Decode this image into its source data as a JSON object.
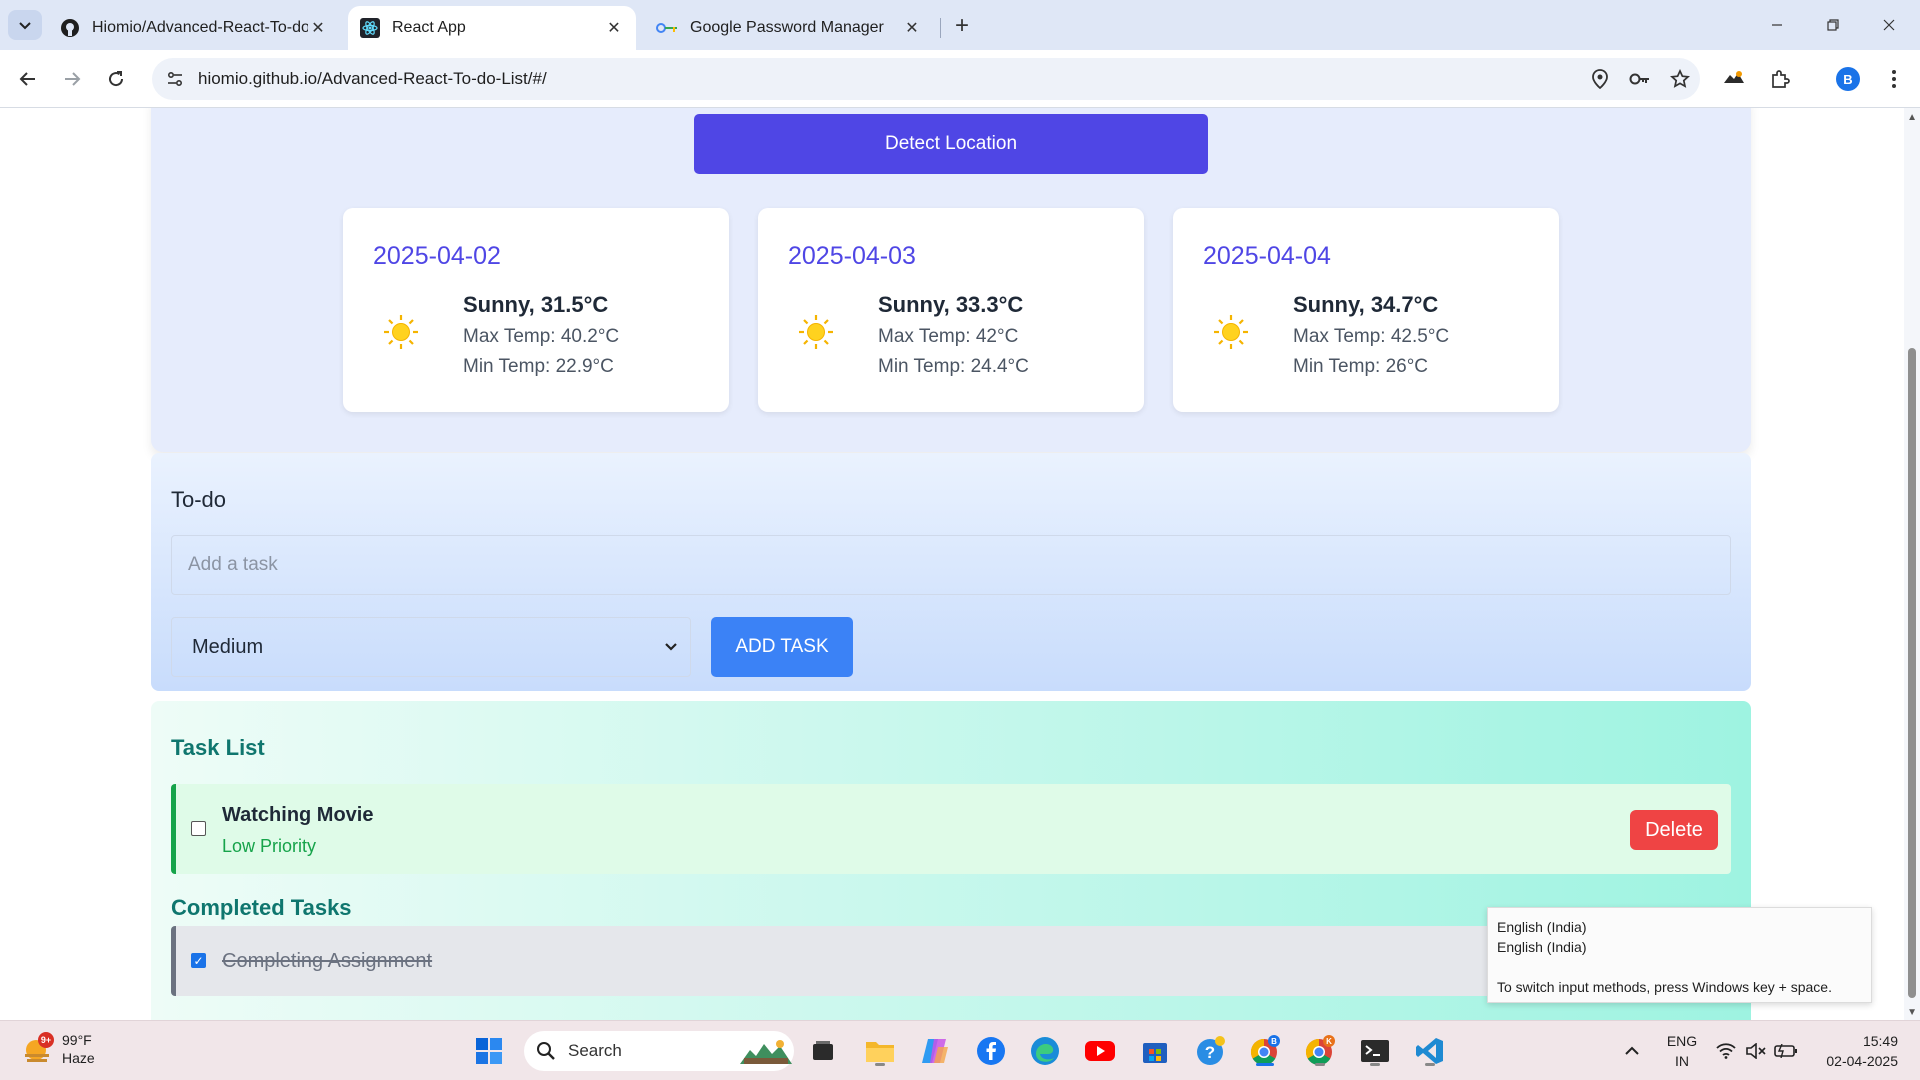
{
  "browser": {
    "tabs": [
      {
        "title": "Hiomio/Advanced-React-To-do",
        "icon": "github-icon",
        "active": false
      },
      {
        "title": "React App",
        "icon": "react-icon",
        "active": true
      },
      {
        "title": "Google Password Manager",
        "icon": "password-manager-icon",
        "active": false
      }
    ],
    "url": "hiomio.github.io/Advanced-React-To-do-List/#/",
    "profile_initial": "B"
  },
  "weather": {
    "detect_button": "Detect Location",
    "forecast": [
      {
        "date": "2025-04-02",
        "condition": "Sunny, 31.5°C",
        "max": "Max Temp: 40.2°C",
        "min": "Min Temp: 22.9°C",
        "icon": "sun-icon"
      },
      {
        "date": "2025-04-03",
        "condition": "Sunny, 33.3°C",
        "max": "Max Temp: 42°C",
        "min": "Min Temp: 24.4°C",
        "icon": "sun-icon"
      },
      {
        "date": "2025-04-04",
        "condition": "Sunny, 34.7°C",
        "max": "Max Temp: 42.5°C",
        "min": "Min Temp: 26°C",
        "icon": "sun-icon"
      }
    ]
  },
  "todo": {
    "title": "To-do",
    "input_placeholder": "Add a task",
    "priority_selected": "Medium",
    "add_button": "ADD TASK"
  },
  "task_list": {
    "title": "Task List",
    "tasks": [
      {
        "name": "Watching Movie",
        "priority": "Low Priority",
        "delete_label": "Delete",
        "checked": false
      }
    ],
    "completed_title": "Completed Tasks",
    "completed": [
      {
        "name": "Completing Assignment",
        "checked": true
      }
    ]
  },
  "ime_tooltip": {
    "line1": "English (India)",
    "line2": "English (India)",
    "line3": "To switch input methods, press Windows key + space."
  },
  "taskbar": {
    "weather_temp": "99°F",
    "weather_condition": "Haze",
    "weather_badge": "9+",
    "search_label": "Search",
    "lang_line1": "ENG",
    "lang_line2": "IN",
    "time": "15:49",
    "date": "02-04-2025"
  },
  "colors": {
    "accent": "#4f46e5",
    "add_button": "#3b82f6",
    "delete_button": "#ef4444",
    "priority_low": "#16a34a"
  }
}
